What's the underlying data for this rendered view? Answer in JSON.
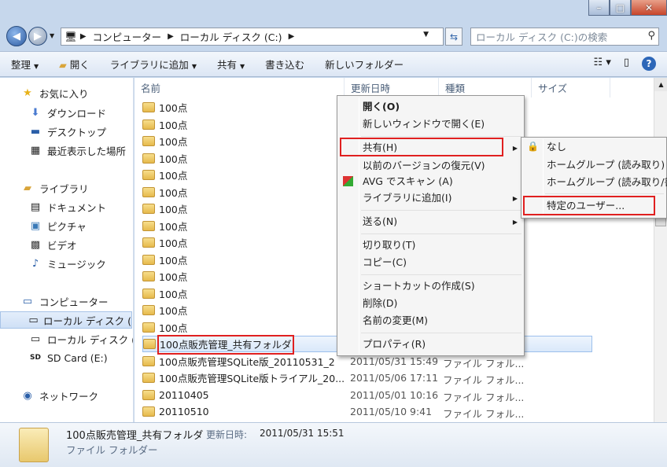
{
  "window": {
    "minimize": "–",
    "maximize": "□",
    "close": "✕"
  },
  "address": {
    "crumbs": [
      "コンピューター",
      "ローカル ディスク (C:)"
    ],
    "search_placeholder": "ローカル ディスク (C:)の検索"
  },
  "toolbar": {
    "organize": "整理",
    "open": "開く",
    "add_library": "ライブラリに追加",
    "share": "共有",
    "burn": "書き込む",
    "new_folder": "新しいフォルダー"
  },
  "nav": {
    "favorites": "お気に入り",
    "downloads": "ダウンロード",
    "desktop": "デスクトップ",
    "recent": "最近表示した場所",
    "libraries": "ライブラリ",
    "documents": "ドキュメント",
    "pictures": "ピクチャ",
    "videos": "ビデオ",
    "music": "ミュージック",
    "computer": "コンピューター",
    "local_disk_c": "ローカル ディスク (",
    "local_disk_2": "ローカル ディスク (",
    "sd_card": "SD Card (E:)",
    "network": "ネットワーク"
  },
  "columns": {
    "name": "名前",
    "date": "更新日時",
    "type": "種類",
    "size": "サイズ"
  },
  "files": [
    {
      "name": "100点",
      "date": "",
      "type": ""
    },
    {
      "name": "100点",
      "date": "",
      "type": ""
    },
    {
      "name": "100点",
      "date": "",
      "type": ""
    },
    {
      "name": "100点",
      "date": "",
      "type": ""
    },
    {
      "name": "100点",
      "date": "",
      "type": ""
    },
    {
      "name": "100点",
      "date": "",
      "type": ""
    },
    {
      "name": "100点",
      "date": "",
      "type": ""
    },
    {
      "name": "100点",
      "date": "",
      "type": ""
    },
    {
      "name": "100点",
      "date": "",
      "type": ""
    },
    {
      "name": "100点",
      "date": "",
      "type": ""
    },
    {
      "name": "100点",
      "date": "",
      "type": ""
    },
    {
      "name": "100点",
      "date": "",
      "type": ""
    },
    {
      "name": "100点",
      "date": "",
      "type": ""
    },
    {
      "name": "100点",
      "date": "",
      "type": ""
    },
    {
      "name": "100点販売管理_共有フォルダ",
      "date": "2011/05/31 15:51",
      "type": "ファイル フォル..."
    },
    {
      "name": "100点販売管理SQLite版_20110531_2",
      "date": "2011/05/31 15:49",
      "type": "ファイル フォル..."
    },
    {
      "name": "100点販売管理SQLite版トライアル_20...",
      "date": "2011/05/06 17:11",
      "type": "ファイル フォル..."
    },
    {
      "name": "20110405",
      "date": "2011/05/01 10:16",
      "type": "ファイル フォル..."
    },
    {
      "name": "20110510",
      "date": "2011/05/10 9:41",
      "type": "ファイル フォル..."
    }
  ],
  "context_menu": {
    "open": "開く(O)",
    "open_new": "新しいウィンドウで開く(E)",
    "share": "共有(H)",
    "restore": "以前のバージョンの復元(V)",
    "avg": "AVG でスキャン (A)",
    "add_library": "ライブラリに追加(I)",
    "send_to": "送る(N)",
    "cut": "切り取り(T)",
    "copy": "コピー(C)",
    "shortcut": "ショートカットの作成(S)",
    "delete": "削除(D)",
    "rename": "名前の変更(M)",
    "properties": "プロパティ(R)"
  },
  "share_submenu": {
    "none": "なし",
    "homegroup_read": "ホームグループ (読み取り)",
    "homegroup_rw": "ホームグループ (読み取り/書",
    "specific_users": "特定のユーザー..."
  },
  "details": {
    "name": "100点販売管理_共有フォルダ",
    "date_label": "更新日時:",
    "date": "2011/05/31 15:51",
    "type": "ファイル フォルダー"
  },
  "colors": {
    "highlight_box": "#e02020",
    "selection": "#cfe0f6"
  }
}
